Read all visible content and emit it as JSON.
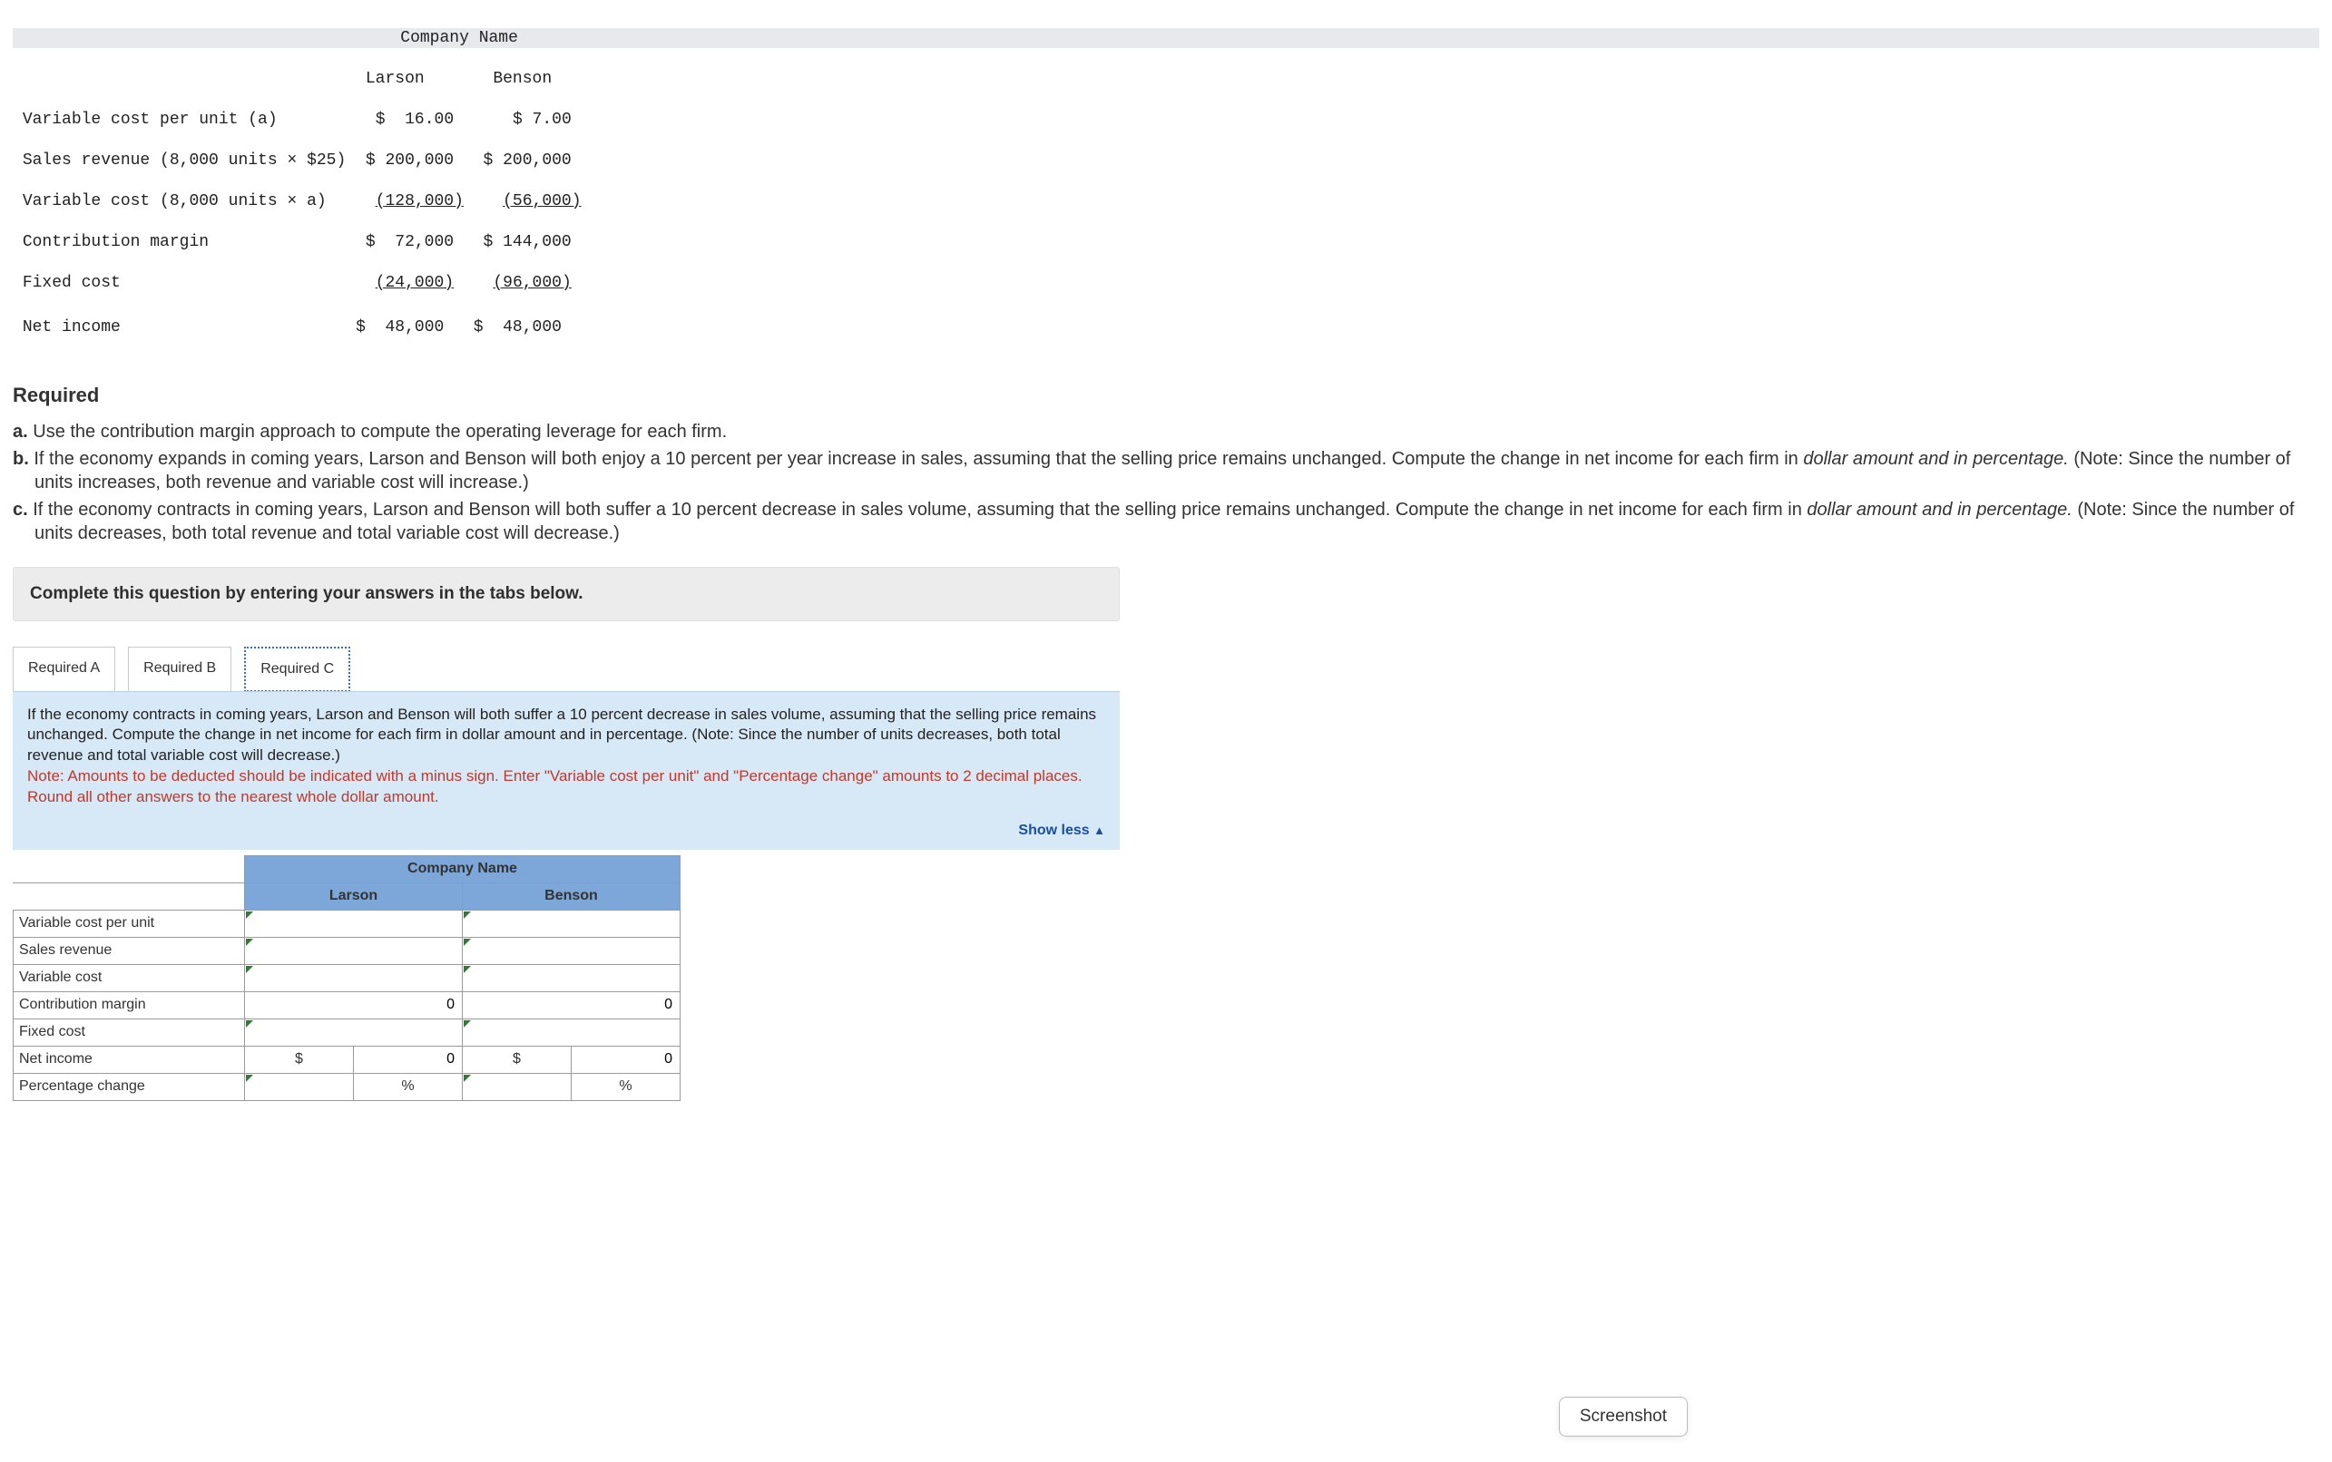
{
  "topTable": {
    "headerGroup": "Company Name",
    "headers": {
      "c1": "Larson",
      "c2": "Benson"
    },
    "rows": [
      {
        "label": "Variable cost per unit (a)",
        "larson": "$  16.00",
        "benson": "$ 7.00"
      },
      {
        "label": "Sales revenue (8,000 units × $25)",
        "larson": "$ 200,000",
        "benson": "$ 200,000"
      },
      {
        "label": "Variable cost (8,000 units × a)",
        "larson": "(128,000)",
        "benson": "(56,000)",
        "underline": true
      },
      {
        "label": "Contribution margin",
        "larson": "$  72,000",
        "benson": "$ 144,000"
      },
      {
        "label": "Fixed cost",
        "larson": "(24,000)",
        "benson": "(96,000)",
        "underline": true
      },
      {
        "label": "Net income",
        "larson": "$  48,000",
        "benson": "$  48,000"
      }
    ]
  },
  "required": {
    "heading": "Required",
    "a": "Use the contribution margin approach to compute the operating leverage for each firm.",
    "b_part1": "If the economy expands in coming years, Larson and Benson will both enjoy a 10 percent per year increase in sales, assuming that the selling price remains unchanged. Compute the change in net income for each firm in ",
    "b_em": "dollar amount and in percentage.",
    "b_part2": " (Note: Since the number of units increases, both revenue and variable cost will increase.)",
    "c_part1": "If the economy contracts in coming years, Larson and Benson will both suffer a 10 percent decrease in sales volume, assuming that the selling price remains unchanged. Compute the change in net income for each firm in ",
    "c_em": "dollar amount and in percentage.",
    "c_part2": " (Note: Since the number of units decreases, both total revenue and total variable cost will decrease.)"
  },
  "instructionBar": "Complete this question by entering your answers in the tabs below.",
  "tabs": {
    "a": "Required A",
    "b": "Required B",
    "c": "Required C"
  },
  "tabBody": {
    "main": "If the economy contracts in coming years, Larson and Benson will both suffer a 10 percent decrease in sales volume, assuming that the selling price remains unchanged. Compute the change in net income for each firm in dollar amount and in percentage. (Note: Since the number of units decreases, both total revenue and total variable cost will decrease.)",
    "note": "Note: Amounts to be deducted should be indicated with a minus sign. Enter \"Variable cost per unit\" and \"Percentage change\" amounts to 2 decimal places. Round all other answers to the nearest whole dollar amount.",
    "showLess": "Show less"
  },
  "answerTable": {
    "groupHeader": "Company Name",
    "colHeaders": {
      "c1": "Larson",
      "c2": "Benson"
    },
    "rowLabels": [
      "Variable cost per unit",
      "Sales revenue",
      "Variable cost",
      "Contribution margin",
      "Fixed cost",
      "Net income",
      "Percentage change"
    ],
    "values": {
      "contribMargin": {
        "larson": "0",
        "benson": "0"
      },
      "netIncome": {
        "larson": "0",
        "benson": "0"
      }
    },
    "symbols": {
      "dollar": "$",
      "percent": "%"
    }
  },
  "toast": "Screenshot"
}
